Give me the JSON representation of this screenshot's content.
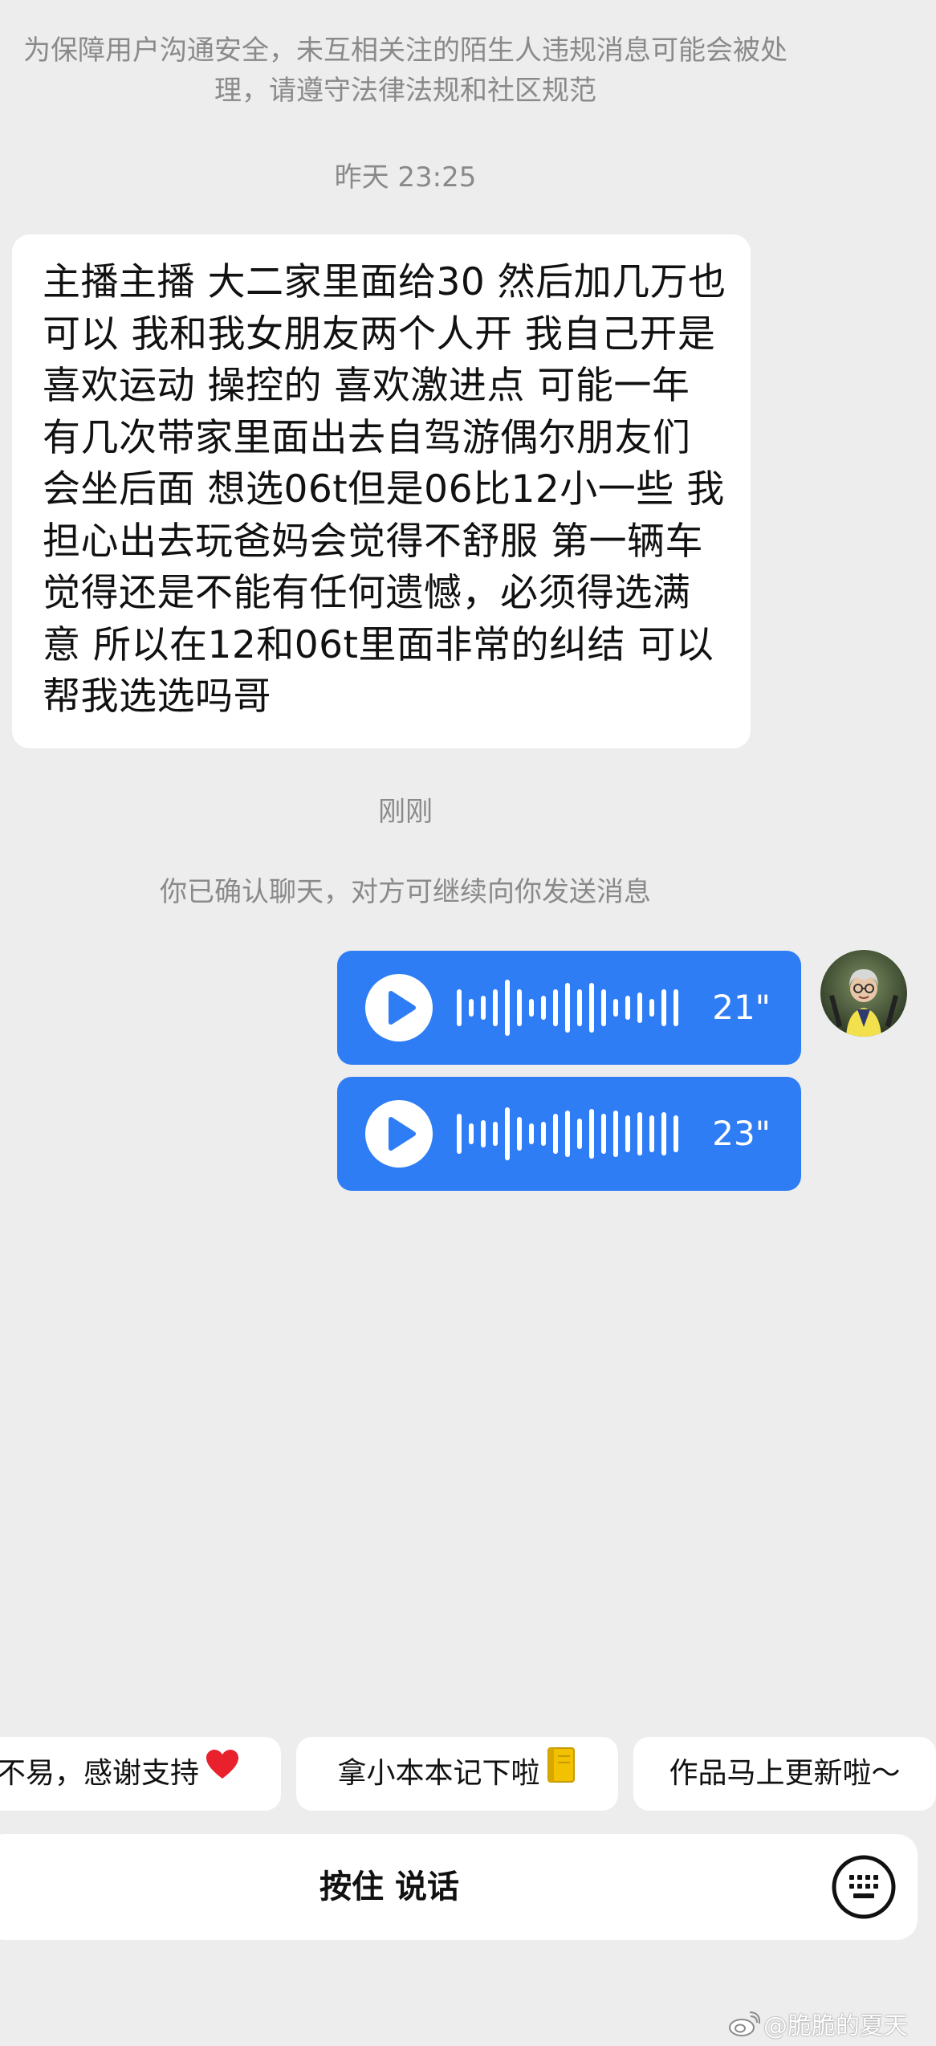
{
  "chat": {
    "notice": "为保障用户沟通安全，未互相关注的陌生人违规消息可能会被处理，请遵守法律法规和社区规范",
    "timestamp_1": "昨天 23:25",
    "incoming_message": "主播主播 大二家里面给30 然后加几万也可以 我和我女朋友两个人开 我自己开是喜欢运动 操控的 喜欢激进点 可能一年有几次带家里面出去自驾游偶尔朋友们会坐后面 想选06t但是06比12小一些 我担心出去玩爸妈会觉得不舒服 第一辆车觉得还是不能有任何遗憾，必须得选满意 所以在12和06t里面非常的纠结  可以帮我选选吗哥",
    "timestamp_2": "刚刚",
    "system_message": "你已确认聊天，对方可继续向你发送消息",
    "voice_messages": [
      {
        "duration": "21\""
      },
      {
        "duration": "23\""
      }
    ]
  },
  "quick_replies": [
    {
      "label": "不易，感谢支持",
      "emoji": "heart-icon"
    },
    {
      "label": "拿小本本记下啦",
      "emoji": "notebook-icon"
    },
    {
      "label": "作品马上更新啦～"
    }
  ],
  "input_bar": {
    "hold_to_talk": "按住 说话",
    "keyboard_icon": "keyboard-icon"
  },
  "watermark": {
    "text": "@脆脆的夏天"
  },
  "colors": {
    "background": "#ededed",
    "voice_bubble": "#2f7df5",
    "text_secondary": "#8a8a8a"
  }
}
